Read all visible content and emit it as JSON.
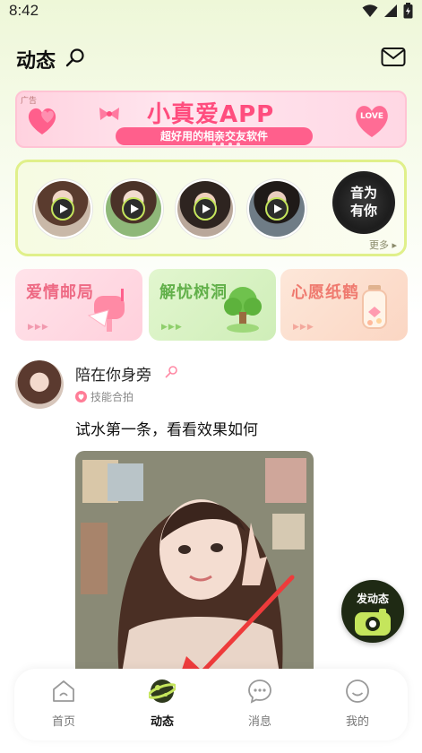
{
  "status_bar": {
    "time": "8:42"
  },
  "header": {
    "title": "动态"
  },
  "banner": {
    "ad_tag": "广告",
    "title": "小真爱APP",
    "subtitle": "超好用的相亲交友软件",
    "love_text": "LOVE"
  },
  "media_row": {
    "vinyl_text_line1": "音为",
    "vinyl_text_line2": "有你",
    "more_label": "更多 ▸"
  },
  "tiles": [
    {
      "label": "爱情邮局",
      "color": "#ee6a84"
    },
    {
      "label": "解忧树洞",
      "color": "#62b04a"
    },
    {
      "label": "心愿纸鹤",
      "color": "#ef7a6f"
    }
  ],
  "post": {
    "username": "陪在你身旁",
    "skill_tag": "技能合拍",
    "text": "试水第一条，看看效果如何"
  },
  "fab": {
    "label": "发动态"
  },
  "nav": {
    "items": [
      {
        "label": "首页",
        "active": false
      },
      {
        "label": "动态",
        "active": true
      },
      {
        "label": "消息",
        "active": false
      },
      {
        "label": "我的",
        "active": false
      }
    ]
  },
  "colors": {
    "accent_green": "#c5e55c",
    "brand_pink": "#ff4d7e",
    "pointer_red": "#ee3b3b"
  }
}
